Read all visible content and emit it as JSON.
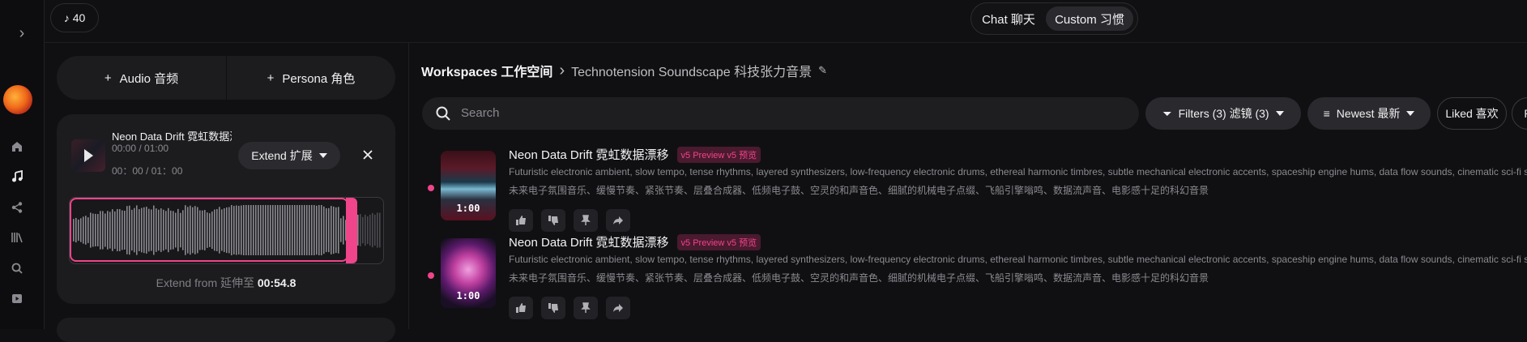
{
  "credits": {
    "value": "40",
    "icon": "music-note-icon"
  },
  "mode": {
    "chat": "Chat  聊天",
    "custom": "Custom  习惯"
  },
  "nav": {
    "icons": [
      "chevron-right-icon",
      "home-icon",
      "music-icon",
      "share-icon",
      "library-icon",
      "search-icon",
      "play-icon"
    ]
  },
  "create": {
    "audio": "Audio  音频",
    "persona": "Persona  角色"
  },
  "extend_card": {
    "title": "Neon Data Drift 霓虹数据漂移",
    "time_en": "00:00 / 01:00",
    "time_zh": "00：00 / 01：00",
    "extend_label": "Extend  扩展",
    "extend_from_label": "Extend from  延伸至",
    "extend_from_value": "00:54.8"
  },
  "breadcrumb": {
    "workspaces": "Workspaces  工作空间",
    "separator": "›",
    "current": "Technotension Soundscape  科技张力音景"
  },
  "search": {
    "placeholder": "Search"
  },
  "filters": {
    "filters_label": "Filters (3)  滤镜 (3)",
    "sort_label": "Newest  最新",
    "liked_label": "Liked  喜欢",
    "more_label": "P"
  },
  "songs": [
    {
      "title": "Neon Data Drift 霓虹数据漂移",
      "badge": "v5 Preview  v5 预览",
      "desc_en": "Futuristic electronic ambient, slow tempo, tense rhythms, layered synthesizers, low-frequency electronic drums, ethereal harmonic timbres, subtle mechanical electronic accents, spaceship engine hums, data flow sounds, cinematic sci-fi soundscape",
      "desc_zh": "未来电子氛围音乐、缓慢节奏、紧张节奏、层叠合成器、低频电子鼓、空灵的和声音色、细腻的机械电子点缀、飞船引擎嗡鸣、数据流声音、电影感十足的科幻音景",
      "duration": "1:00"
    },
    {
      "title": "Neon Data Drift 霓虹数据漂移",
      "badge": "v5 Preview  v5 预览",
      "desc_en": "Futuristic electronic ambient, slow tempo, tense rhythms, layered synthesizers, low-frequency electronic drums, ethereal harmonic timbres, subtle mechanical electronic accents, spaceship engine hums, data flow sounds, cinematic sci-fi soundscape",
      "desc_zh": "未来电子氛围音乐、缓慢节奏、紧张节奏、层叠合成器、低频电子鼓、空灵的和声音色、细腻的机械电子点缀、飞船引擎嗡鸣、数据流声音、电影感十足的科幻音景",
      "duration": "1:00"
    }
  ],
  "colors": {
    "accent": "#f0448b",
    "bg": "#101012",
    "panel": "#1c1c1f"
  }
}
